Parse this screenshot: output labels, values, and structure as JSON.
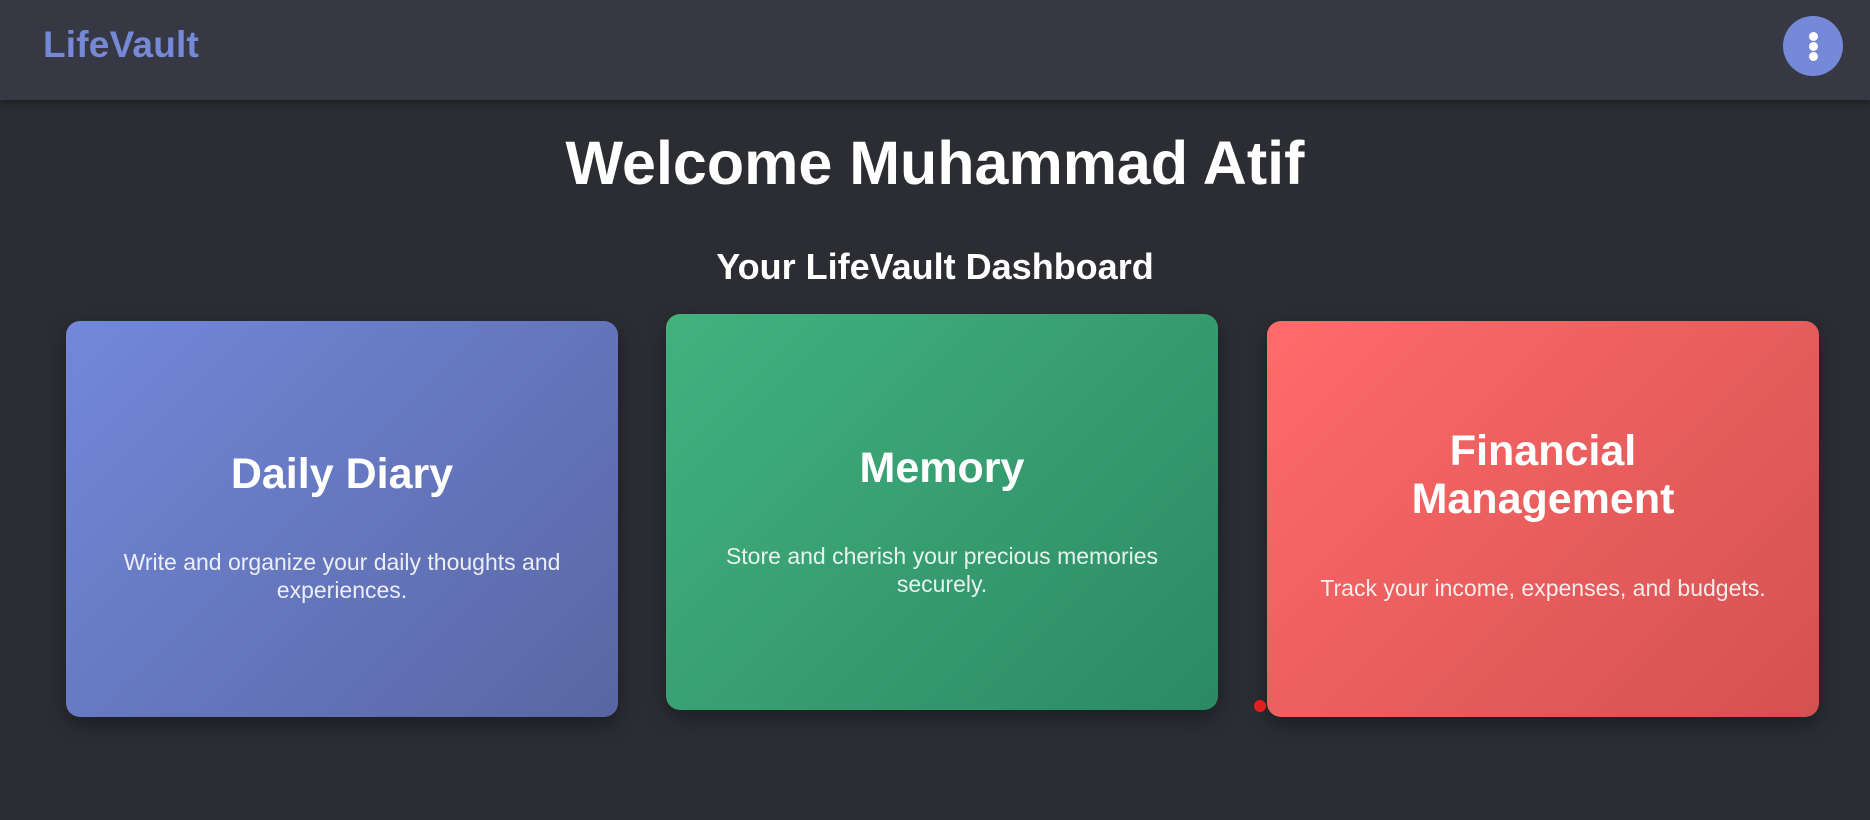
{
  "app": {
    "brand": "LifeVault"
  },
  "header": {
    "menu_icon": "kebab-vertical-icon"
  },
  "main": {
    "welcome": "Welcome Muhammad Atif",
    "subtitle": "Your LifeVault Dashboard",
    "cards": [
      {
        "title": "Daily Diary",
        "description": "Write and organize your daily thoughts and experiences.",
        "color_start": "#7388da",
        "color_end": "#5866a3"
      },
      {
        "title": "Memory",
        "description": "Store and cherish your precious memories securely.",
        "color_start": "#43b27f",
        "color_end": "#2b8a63"
      },
      {
        "title": "Financial Management",
        "description": "Track your income, expenses, and budgets.",
        "color_start": "#ff6b6a",
        "color_end": "#d45151"
      }
    ]
  },
  "colors": {
    "background": "#2b2d33",
    "navbar": "#363944",
    "accent": "#7589d8"
  }
}
